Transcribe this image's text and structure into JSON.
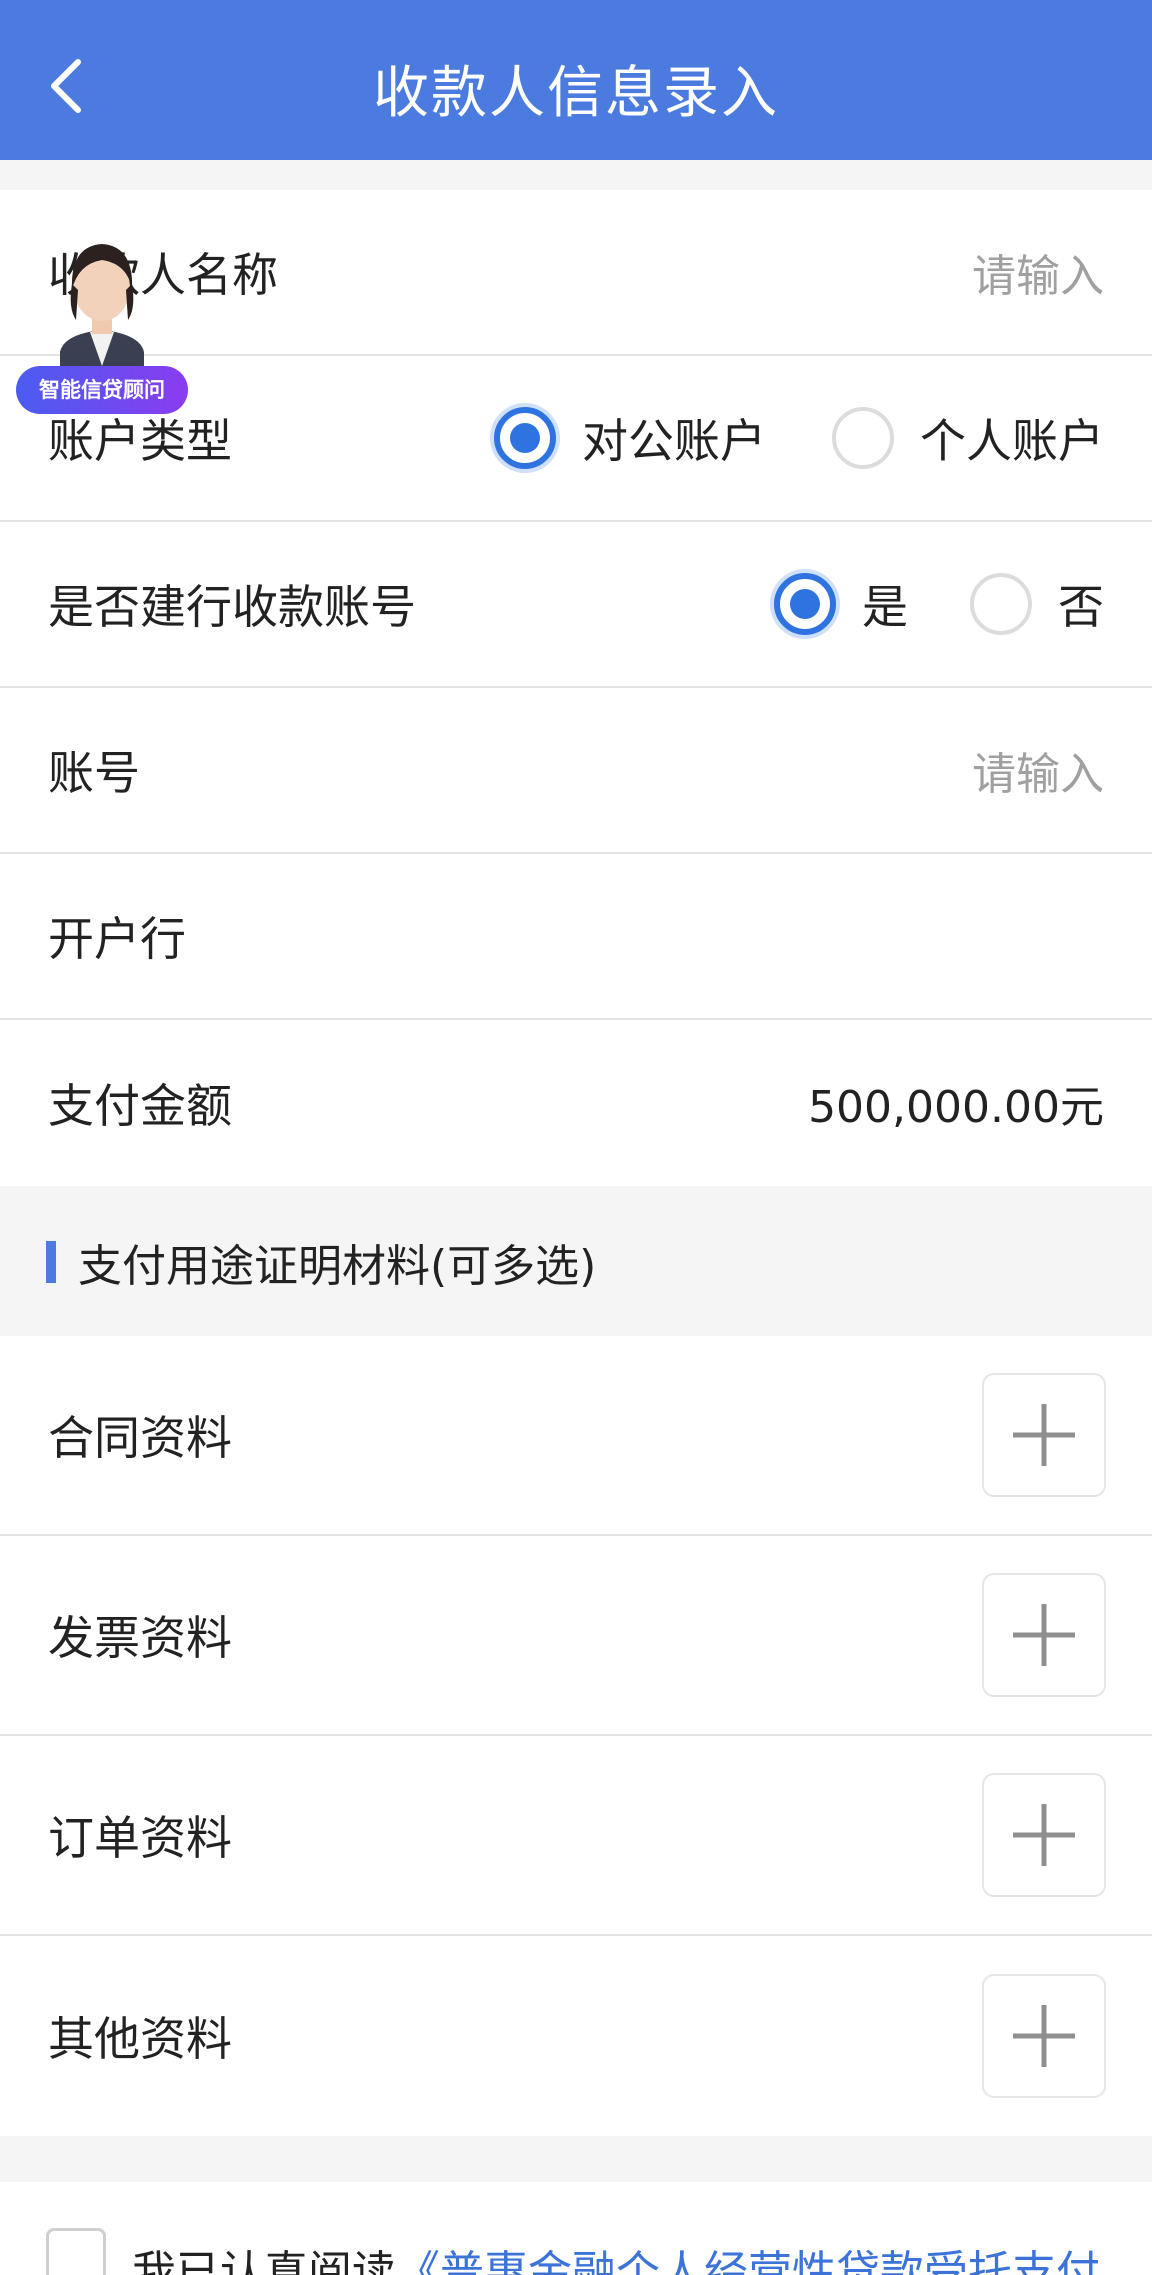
{
  "header": {
    "title": "收款人信息录入"
  },
  "payee_form": {
    "name": {
      "label": "收款人名称",
      "placeholder": "请输入"
    },
    "account_type": {
      "label": "账户类型",
      "options": [
        "对公账户",
        "个人账户"
      ],
      "selected": "对公账户"
    },
    "is_ccb": {
      "label": "是否建行收款账号",
      "options": [
        "是",
        "否"
      ],
      "selected": "是"
    },
    "account_no": {
      "label": "账号",
      "placeholder": "请输入"
    },
    "bank": {
      "label": "开户行"
    },
    "amount": {
      "label": "支付金额",
      "value": "500,000.00元"
    }
  },
  "materials": {
    "title": "支付用途证明材料(可多选)",
    "items": [
      {
        "label": "合同资料"
      },
      {
        "label": "发票资料"
      },
      {
        "label": "订单资料"
      },
      {
        "label": "其他资料"
      }
    ]
  },
  "agreement": {
    "prefix": "我已认真阅读",
    "link": "《普惠金融个人经营性贷款受托支付"
  },
  "advisor": {
    "badge": "智能信贷顾问"
  },
  "colors": {
    "primary": "#4c7be0",
    "radio_on": "#2f73e0",
    "link": "#3b73d9"
  }
}
